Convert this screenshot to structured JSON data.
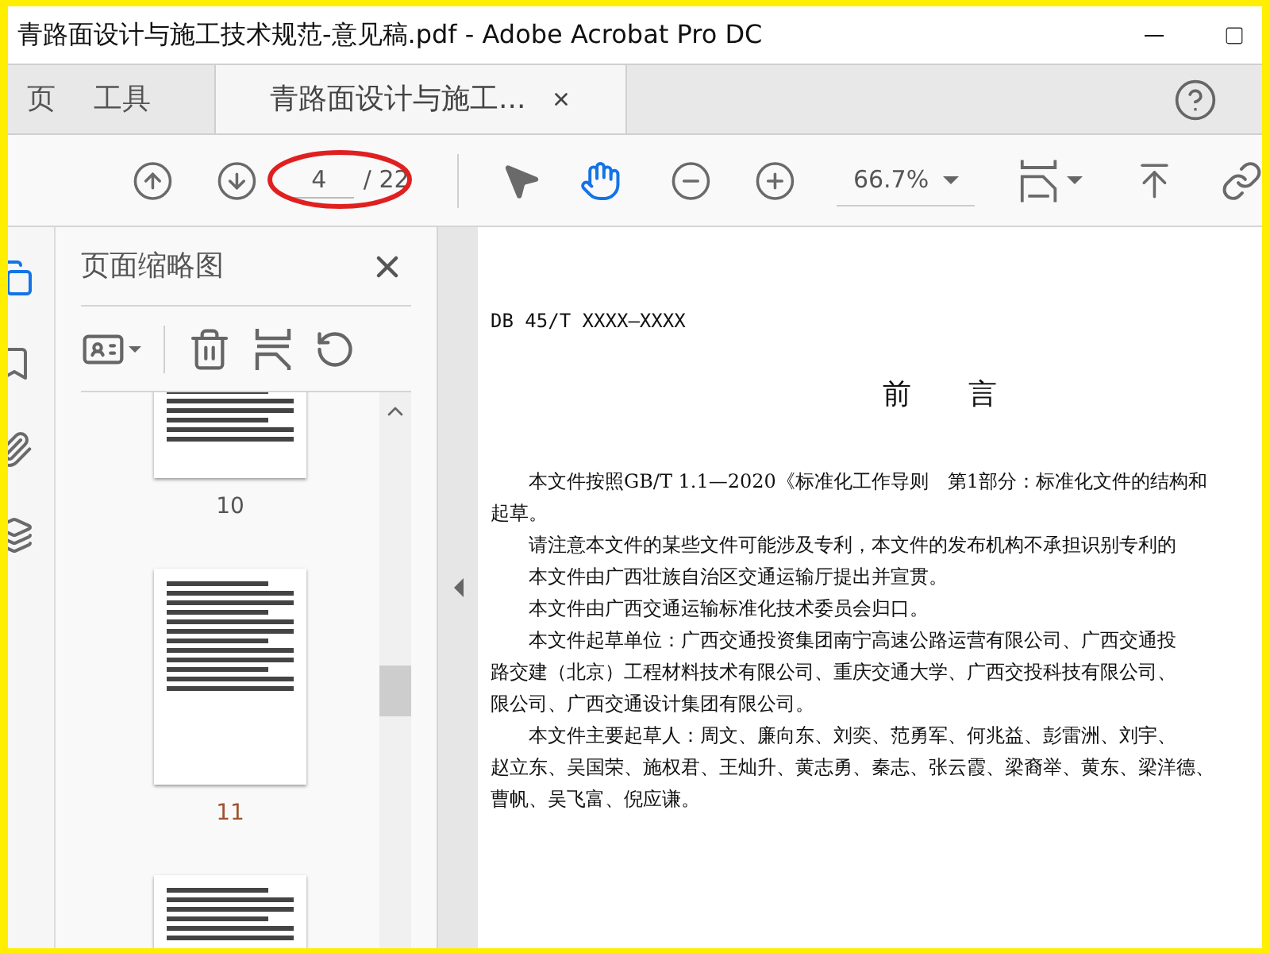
{
  "window": {
    "title": "青路面设计与施工技术规范-意见稿.pdf - Adobe Acrobat Pro DC"
  },
  "tabs": [
    {
      "label": "页",
      "selected": false,
      "closable": false
    },
    {
      "label": "工具",
      "selected": false,
      "closable": false
    },
    {
      "label": "青路面设计与施工...",
      "selected": true,
      "closable": true
    }
  ],
  "toolbar": {
    "page_number": "4",
    "page_total": "/ 22",
    "zoom": "66.7%",
    "tools": [
      {
        "kind": "select",
        "selected": false
      },
      {
        "kind": "hand",
        "selected": true
      }
    ]
  },
  "sidebar": {
    "rail": [
      {
        "kind": "pages",
        "selected": true
      },
      {
        "kind": "bookmarks",
        "selected": false
      },
      {
        "kind": "attachments",
        "selected": false
      },
      {
        "kind": "layers",
        "selected": false
      }
    ]
  },
  "thumbnails_panel": {
    "title": "页面缩略图",
    "pages": [
      {
        "label": "10"
      },
      {
        "label": "11"
      }
    ]
  },
  "document": {
    "header": "DB 45/T XXXX—XXXX",
    "heading": "前　　言",
    "lines": [
      {
        "text": "本文件按照GB/T 1.1—2020《标准化工作导则　第1部分：标准化文件的结构和",
        "indent": true
      },
      {
        "text": "起草。",
        "indent": false
      },
      {
        "text": "请注意本文件的某些文件可能涉及专利，本文件的发布机构不承担识别专利的",
        "indent": true
      },
      {
        "text": "本文件由广西壮族自治区交通运输厅提出并宣贯。",
        "indent": true
      },
      {
        "text": "本文件由广西交通运输标准化技术委员会归口。",
        "indent": true
      },
      {
        "text": "本文件起草单位：广西交通投资集团南宁高速公路运营有限公司、广西交通投",
        "indent": true
      },
      {
        "text": "路交建（北京）工程材料技术有限公司、重庆交通大学、广西交投科技有限公司、",
        "indent": false
      },
      {
        "text": "限公司、广西交通设计集团有限公司。",
        "indent": false
      },
      {
        "text": "本文件主要起草人：周文、廉向东、刘奕、范勇军、何兆益、彭雷洲、刘宇、",
        "indent": true
      },
      {
        "text": "赵立东、吴国荣、施权君、王灿升、黄志勇、秦志、张云霞、梁裔举、黄东、梁洋德、",
        "indent": false
      },
      {
        "text": "曹帆、吴飞富、倪应谦。",
        "indent": false
      }
    ]
  }
}
